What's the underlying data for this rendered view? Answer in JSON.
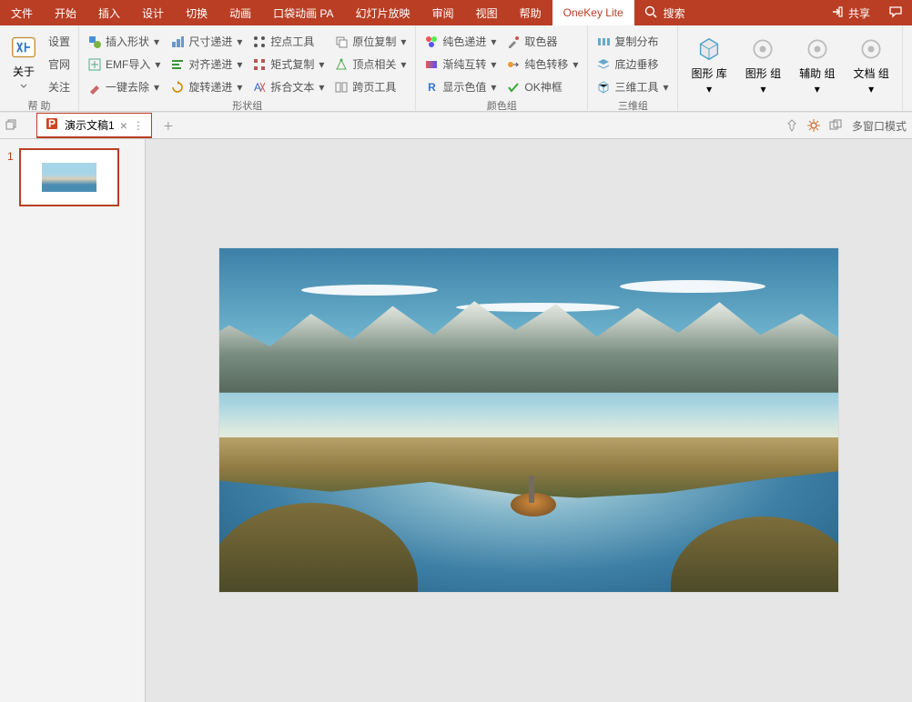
{
  "tabs": {
    "file": "文件",
    "home": "开始",
    "insert": "插入",
    "design": "设计",
    "transition": "切换",
    "animation": "动画",
    "pocket": "口袋动画 PA",
    "slideshow": "幻灯片放映",
    "review": "审阅",
    "view": "视图",
    "help": "帮助",
    "onekey": "OneKey Lite"
  },
  "search_placeholder": "搜索",
  "share": "共享",
  "help_group": {
    "settings": "设置",
    "official": "官网",
    "about": "关于",
    "attention": "关注",
    "label": "帮 助"
  },
  "shape_group": {
    "insert_shape": "插入形状",
    "emf_import": "EMF导入",
    "one_click_remove": "一键去除",
    "size_step": "尺寸递进",
    "align_step": "对齐递进",
    "rotate_step": "旋转递进",
    "ctrl_point": "控点工具",
    "matrix_copy": "矩式复制",
    "split_text": "拆合文本",
    "orig_copy": "原位复制",
    "vertex_rel": "顶点相关",
    "cross_page": "跨页工具",
    "label": "形状组"
  },
  "color_group": {
    "pure_step": "纯色递进",
    "grad_swap": "渐纯互转",
    "show_cv": "显示色值",
    "picker": "取色器",
    "pure_trans": "纯色转移",
    "ok_frame": "OK神框",
    "label": "颜色组"
  },
  "three_group": {
    "copy_dist": "复制分布",
    "bottom_v": "底边垂移",
    "three_tool": "三维工具",
    "label": "三维组"
  },
  "lib_group": {
    "lib": "图形\n库",
    "shape_grp": "图形\n组",
    "aux_grp": "辅助\n组",
    "doc_grp": "文档\n组"
  },
  "doc_tab": {
    "name": "演示文稿1"
  },
  "slide_num": "1",
  "multi_window": "多窗口模式"
}
